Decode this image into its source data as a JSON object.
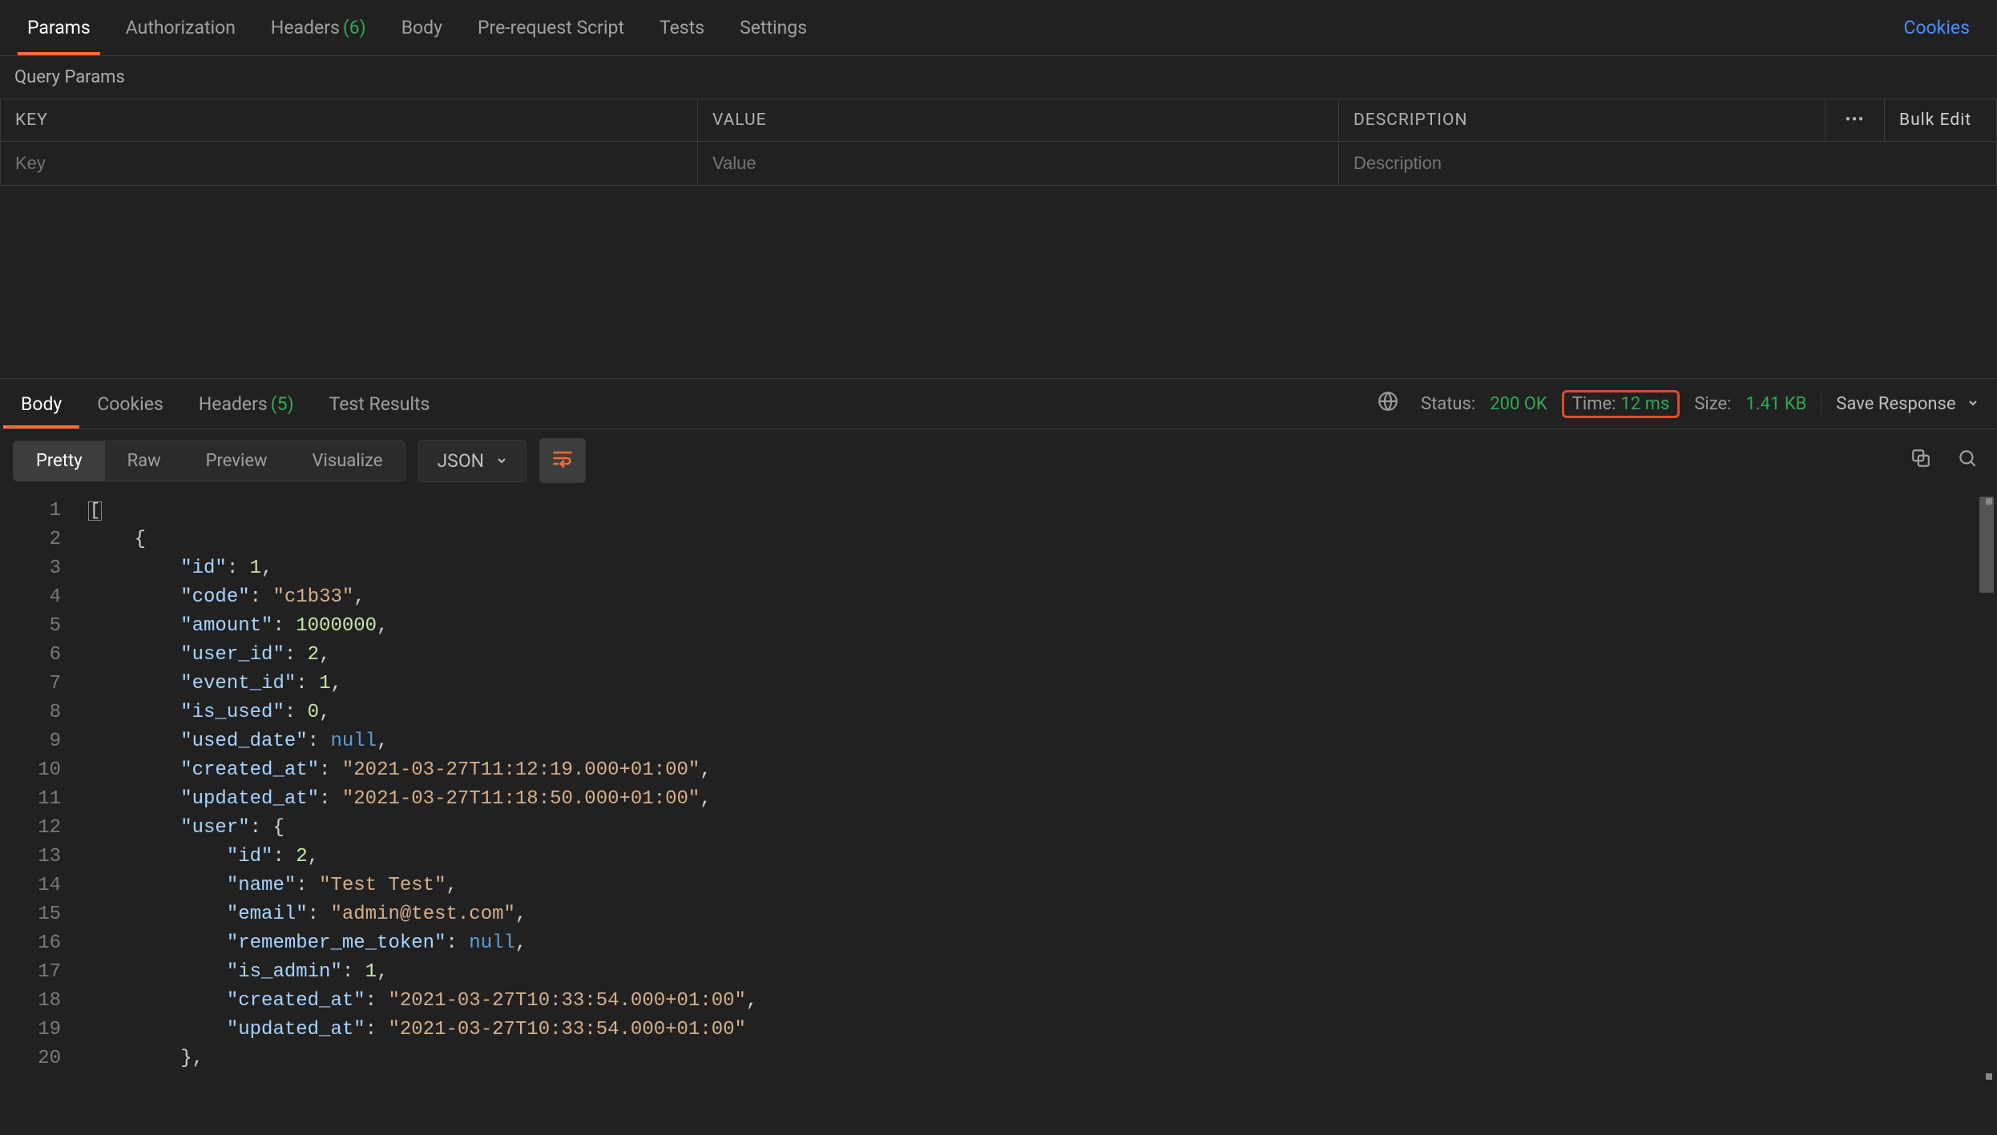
{
  "request_tabs": {
    "params": "Params",
    "authorization": "Authorization",
    "headers": "Headers",
    "headers_count": "(6)",
    "body": "Body",
    "pre_request": "Pre-request Script",
    "tests": "Tests",
    "settings": "Settings",
    "cookies": "Cookies"
  },
  "query_params": {
    "title": "Query Params",
    "head_key": "KEY",
    "head_value": "VALUE",
    "head_desc": "DESCRIPTION",
    "bulk_edit": "Bulk Edit",
    "placeholder_key": "Key",
    "placeholder_value": "Value",
    "placeholder_desc": "Description"
  },
  "response_tabs": {
    "body": "Body",
    "cookies": "Cookies",
    "headers": "Headers",
    "headers_count": "(5)",
    "test_results": "Test Results"
  },
  "status": {
    "status_label": "Status:",
    "status_code": "200 OK",
    "time_label": "Time:",
    "time_value": "12 ms",
    "size_label": "Size:",
    "size_value": "1.41 KB",
    "save_response": "Save Response"
  },
  "view_modes": {
    "pretty": "Pretty",
    "raw": "Raw",
    "preview": "Preview",
    "visualize": "Visualize",
    "format": "JSON"
  },
  "gutter": [
    "1",
    "2",
    "3",
    "4",
    "5",
    "6",
    "7",
    "8",
    "9",
    "10",
    "11",
    "12",
    "13",
    "14",
    "15",
    "16",
    "17",
    "18",
    "19",
    "20"
  ],
  "json_body": {
    "l1_bracket": "[",
    "l2_brace": "{",
    "l3_k": "\"id\"",
    "l3_v": "1",
    "l4_k": "\"code\"",
    "l4_v": "\"c1b33\"",
    "l5_k": "\"amount\"",
    "l5_v": "1000000",
    "l6_k": "\"user_id\"",
    "l6_v": "2",
    "l7_k": "\"event_id\"",
    "l7_v": "1",
    "l8_k": "\"is_used\"",
    "l8_v": "0",
    "l9_k": "\"used_date\"",
    "l9_v": "null",
    "l10_k": "\"created_at\"",
    "l10_v": "\"2021-03-27T11:12:19.000+01:00\"",
    "l11_k": "\"updated_at\"",
    "l11_v": "\"2021-03-27T11:18:50.000+01:00\"",
    "l12_k": "\"user\"",
    "l12_v": "{",
    "l13_k": "\"id\"",
    "l13_v": "2",
    "l14_k": "\"name\"",
    "l14_v": "\"Test Test\"",
    "l15_k": "\"email\"",
    "l15_v": "\"admin@test.com\"",
    "l16_k": "\"remember_me_token\"",
    "l16_v": "null",
    "l17_k": "\"is_admin\"",
    "l17_v": "1",
    "l18_k": "\"created_at\"",
    "l18_v": "\"2021-03-27T10:33:54.000+01:00\"",
    "l19_k": "\"updated_at\"",
    "l19_v": "\"2021-03-27T10:33:54.000+01:00\"",
    "l20_brace": "},"
  }
}
